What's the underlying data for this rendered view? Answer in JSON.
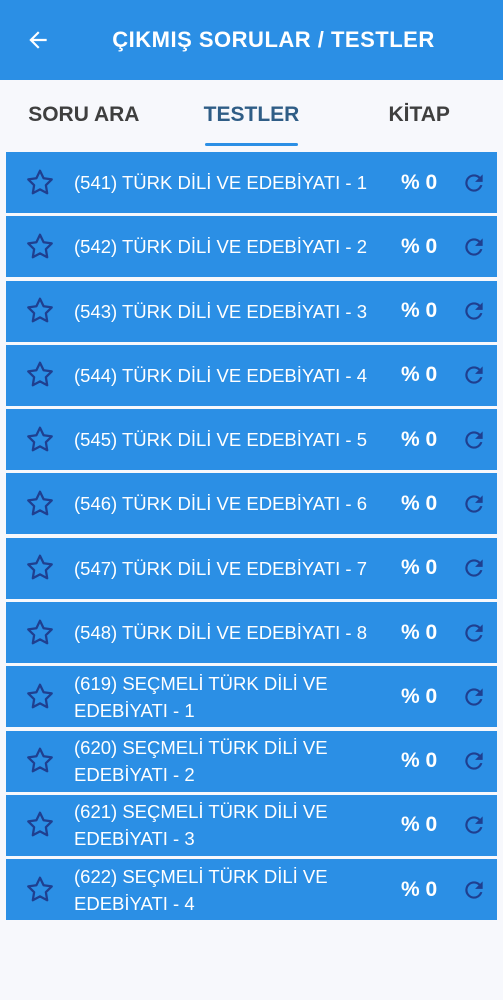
{
  "appbar": {
    "title": "ÇIKMIŞ SORULAR / TESTLER",
    "back_icon": "arrow-left-icon",
    "color": "#2b8fe5"
  },
  "tabs": [
    {
      "label": "SORU ARA",
      "active": false
    },
    {
      "label": "TESTLER",
      "active": true
    },
    {
      "label": "KİTAP",
      "active": false
    }
  ],
  "tests": [
    {
      "title": "(541) TÜRK DİLİ VE EDEBİYATI - 1",
      "percent": "% 0"
    },
    {
      "title": "(542) TÜRK DİLİ VE EDEBİYATI - 2",
      "percent": "% 0"
    },
    {
      "title": "(543) TÜRK DİLİ VE EDEBİYATI - 3",
      "percent": "% 0"
    },
    {
      "title": "(544) TÜRK DİLİ VE EDEBİYATI - 4",
      "percent": "% 0"
    },
    {
      "title": "(545) TÜRK DİLİ VE EDEBİYATI - 5",
      "percent": "% 0"
    },
    {
      "title": "(546) TÜRK DİLİ VE EDEBİYATI - 6",
      "percent": "% 0"
    },
    {
      "title": "(547) TÜRK DİLİ VE EDEBİYATI - 7",
      "percent": "% 0"
    },
    {
      "title": "(548) TÜRK DİLİ VE EDEBİYATI - 8",
      "percent": "% 0"
    },
    {
      "title": "(619) SEÇMELİ TÜRK DİLİ VE EDEBİYATI - 1",
      "percent": "% 0"
    },
    {
      "title": "(620) SEÇMELİ TÜRK DİLİ VE EDEBİYATI - 2",
      "percent": "% 0"
    },
    {
      "title": "(621) SEÇMELİ TÜRK DİLİ VE EDEBİYATI - 3",
      "percent": "% 0"
    },
    {
      "title": "(622) SEÇMELİ TÜRK DİLİ VE EDEBİYATI - 4",
      "percent": "% 0"
    }
  ],
  "icons": {
    "favorite": "star-outline-icon",
    "reset": "refresh-icon"
  },
  "colors": {
    "primary": "#2b8fe5",
    "icon_dark": "#1f3f8f",
    "tab_active": "#2f5d86"
  }
}
